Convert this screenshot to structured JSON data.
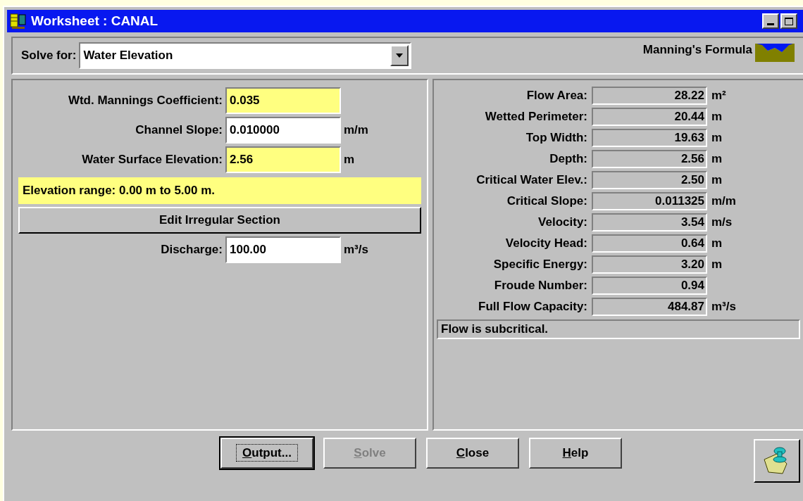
{
  "window": {
    "title": "Worksheet : CANAL"
  },
  "solve_for": {
    "label": "Solve for:",
    "value": "Water Elevation"
  },
  "formula": {
    "label": "Manning's Formula"
  },
  "inputs_top": [
    {
      "label": "Wtd. Mannings Coefficient:",
      "value": "0.035",
      "highlighted": true
    },
    {
      "label": "Channel Slope:",
      "value": "0.010000",
      "unit": "m/m",
      "highlighted": false
    },
    {
      "label": "Water Surface Elevation:",
      "value": "2.56",
      "unit": "m",
      "highlighted": true
    }
  ],
  "range_message": "Elevation range: 0.00 m to 5.00 m.",
  "edit_button": "Edit Irregular Section",
  "inputs_bottom": [
    {
      "label": "Discharge:",
      "value": "100.00",
      "unit": "m³/s",
      "highlighted": false
    }
  ],
  "results": [
    {
      "label": "Flow Area:",
      "value": "28.22",
      "unit": "m²"
    },
    {
      "label": "Wetted Perimeter:",
      "value": "20.44",
      "unit": "m"
    },
    {
      "label": "Top Width:",
      "value": "19.63",
      "unit": "m"
    },
    {
      "label": "Depth:",
      "value": "2.56",
      "unit": "m"
    },
    {
      "label": "Critical Water Elev.:",
      "value": "2.50",
      "unit": "m"
    },
    {
      "label": "Critical Slope:",
      "value": "0.011325",
      "unit": "m/m"
    },
    {
      "label": "Velocity:",
      "value": "3.54",
      "unit": "m/s"
    },
    {
      "label": "Velocity Head:",
      "value": "0.64",
      "unit": "m"
    },
    {
      "label": "Specific Energy:",
      "value": "3.20",
      "unit": "m"
    },
    {
      "label": "Froude Number:",
      "value": "0.94"
    },
    {
      "label": "Full Flow Capacity:",
      "value": "484.87",
      "unit": "m³/s"
    }
  ],
  "status_message": "Flow is subcritical.",
  "buttons": [
    {
      "label": "Output...",
      "disabled": false,
      "focused": true
    },
    {
      "label": "Solve",
      "disabled": true,
      "focused": false
    },
    {
      "label": "Close",
      "disabled": false,
      "focused": false
    },
    {
      "label": "Help",
      "disabled": false,
      "focused": false
    }
  ]
}
